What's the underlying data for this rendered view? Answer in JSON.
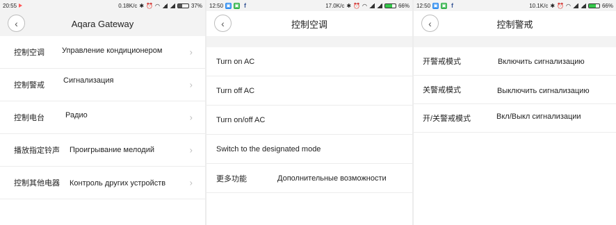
{
  "screen1": {
    "status": {
      "time": "20:55",
      "speed": "0.18K/c",
      "battery": "37%"
    },
    "title": "Aqara Gateway",
    "items": [
      {
        "zh": "控制空调",
        "ru": "Управление кондиционером"
      },
      {
        "zh": "控制警戒",
        "ru": "Сигнализация"
      },
      {
        "zh": "控制电台",
        "ru": "Радио"
      },
      {
        "zh": "播放指定铃声",
        "ru": "Проигрывание мелодий"
      },
      {
        "zh": "控制其他电器",
        "ru": "Контроль других устройств"
      }
    ]
  },
  "screen2": {
    "status": {
      "time": "12:50",
      "speed": "17.0K/c",
      "battery": "66%"
    },
    "title": "控制空调",
    "items": [
      {
        "label": "Turn on AC"
      },
      {
        "label": "Turn off AC"
      },
      {
        "label": "Turn on/off AC"
      },
      {
        "label": "Switch to the designated mode"
      },
      {
        "zh": "更多功能",
        "ru": "Дополнительные возможности"
      }
    ]
  },
  "screen3": {
    "status": {
      "time": "12:50",
      "speed": "10.1K/c",
      "battery": "66%"
    },
    "title": "控制警戒",
    "items": [
      {
        "zh": "开警戒模式",
        "ru": "Включить сигнализацию"
      },
      {
        "zh": "关警戒模式",
        "ru": "Выключить сигнализацию"
      },
      {
        "zh": "开/关警戒模式",
        "ru": "Вкл/Выкл сигнализации"
      }
    ]
  },
  "icons": {
    "back": "‹",
    "chevron": "›",
    "facebook": "f"
  }
}
